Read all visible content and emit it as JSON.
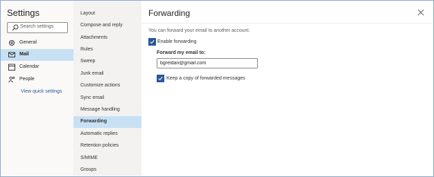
{
  "nav": {
    "title": "Settings",
    "search_placeholder": "Search settings",
    "items": [
      {
        "label": "General",
        "icon": "gear-icon"
      },
      {
        "label": "Mail",
        "icon": "mail-icon"
      },
      {
        "label": "Calendar",
        "icon": "calendar-icon"
      },
      {
        "label": "People",
        "icon": "people-icon"
      }
    ],
    "quick_settings": "View quick settings"
  },
  "categories": [
    "Layout",
    "Compose and reply",
    "Attachments",
    "Rules",
    "Sweep",
    "Junk email",
    "Customize actions",
    "Sync email",
    "Message handling",
    "Forwarding",
    "Automatic replies",
    "Retention policies",
    "S/MIME",
    "Groups"
  ],
  "pane": {
    "title": "Forwarding",
    "description": "You can forward your email to another account.",
    "enable_forwarding": "Enable forwarding",
    "forward_to_label": "Forward my email to:",
    "forward_to_value": "bgreidan@gmail.com",
    "keep_copy": "Keep a copy of forwarded messages"
  },
  "colors": {
    "accent": "#2b5797",
    "selected_bg": "#c7e0f4"
  }
}
